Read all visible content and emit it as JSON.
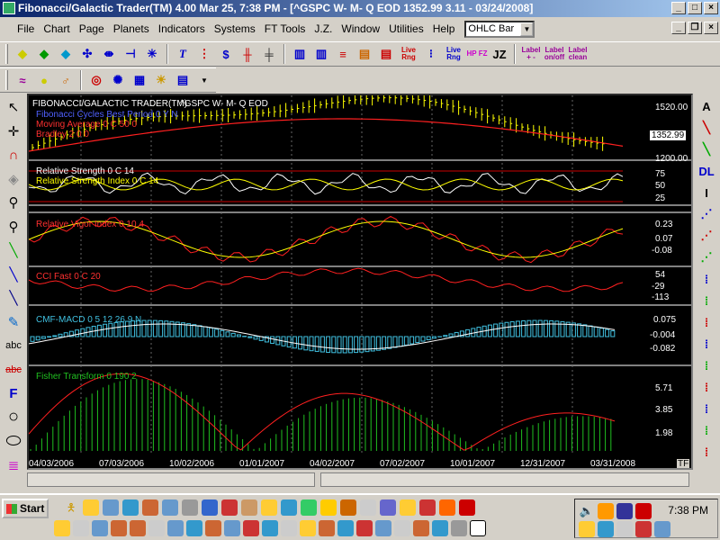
{
  "window": {
    "title": "Fibonacci/Galactic Trader(TM) 4.00 Mar 25,  7:38 PM - [^GSPC W- M- Q EOD  1352.99     3.11 - 03/24/2008]",
    "minimize": "_",
    "maximize": "□",
    "close": "×"
  },
  "menu": {
    "items": [
      "File",
      "Chart",
      "Page",
      "Planets",
      "Indicators",
      "Systems",
      "FT Tools",
      "J.Z.",
      "Window",
      "Utilities",
      "Help"
    ],
    "chart_type": "OHLC Bar"
  },
  "toolbar": {
    "live_rng_1": "Live Rng",
    "live_rng_2": "Live Rng",
    "hp_fz": "HP FZ",
    "jz": "JZ",
    "label_pm": "Label + -",
    "label_onoff": "Label on/off",
    "label_clean": "Label clean"
  },
  "left_tools": {
    "abc": "abc",
    "abc_strike": "abc",
    "font_f": "F"
  },
  "right_tools": {
    "a": "A",
    "dl": "DL",
    "i": "I"
  },
  "chart": {
    "header_left": "FIBONACCI/GALACTIC TRADER(TM)",
    "header_symbol": "^GSPC W- M- Q EOD",
    "price_last": "1352.99",
    "tf_badge": "TF",
    "panels": [
      {
        "name": "price",
        "labels": [
          "Fibonacci Cycles Best Period 0 Y N",
          "Moving Average 0 C 50 0",
          "Bradley 2 0 0"
        ],
        "axis": [
          "1520.00",
          "1200.00"
        ]
      },
      {
        "name": "rsi",
        "labels": [
          "Relative Strength 0 C 14",
          "Relative Strength Index 0 C 14"
        ],
        "axis": [
          "75",
          "50",
          "25"
        ]
      },
      {
        "name": "rvi",
        "labels": [
          "Relative Vigor Index 0 10 4"
        ],
        "axis": [
          "0.23",
          "0.07",
          "-0.08"
        ]
      },
      {
        "name": "cci",
        "labels": [
          "CCI Fast 0 C 20"
        ],
        "axis": [
          "54",
          "-29",
          "-113"
        ]
      },
      {
        "name": "cmf-macd",
        "labels": [
          "CMF-MACD 0 5 12 26 9 N"
        ],
        "axis": [
          "0.075",
          "-0.004",
          "-0.082"
        ]
      },
      {
        "name": "fisher",
        "labels": [
          "Fisher Transform 0 190 2"
        ],
        "axis": [
          "5.71",
          "3.85",
          "1.98"
        ]
      }
    ],
    "dates": [
      "04/03/2006",
      "07/03/2006",
      "10/02/2006",
      "01/01/2007",
      "04/02/2007",
      "07/02/2007",
      "10/01/2007",
      "12/31/2007",
      "03/31/2008"
    ],
    "colors": {
      "price_bars": "#ffff00",
      "ma": "#ff2020",
      "fib": "#3040ff",
      "rsi_white": "#ffffff",
      "rsi_yellow": "#ffff00",
      "rvi_red": "#ff2020",
      "rvi_yellow": "#ffff00",
      "cmf_hist": "#40c0e0",
      "fisher_hist": "#20c020"
    }
  },
  "taskbar": {
    "start": "Start",
    "clock": "7:38 PM"
  }
}
